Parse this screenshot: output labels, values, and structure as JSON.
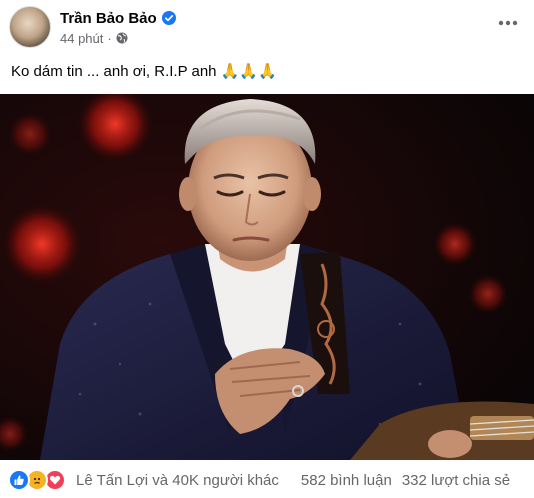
{
  "post": {
    "author": "Trần Bảo Bảo",
    "time": "44 phút",
    "separator": "·",
    "text": "Ko dám tin ... anh ơi, R.I.P anh",
    "text_emoji": "🙏🙏🙏",
    "verified": true
  },
  "icons": {
    "avatar": "avatar",
    "verified": "verified-badge-icon",
    "privacy": "globe-icon",
    "more": "more-options-icon",
    "reactions": [
      "like-icon",
      "sad-icon",
      "love-icon"
    ]
  },
  "footer": {
    "reactors": "Lê Tấn Lợi và 40K người khác",
    "comments": "582 bình luận",
    "shares": "332 lượt chia sẻ"
  },
  "colors": {
    "accent": "#1877f2",
    "muted_text": "#65676b",
    "like": "#1877f2",
    "sad": "#f7b125",
    "love": "#f33e58"
  }
}
